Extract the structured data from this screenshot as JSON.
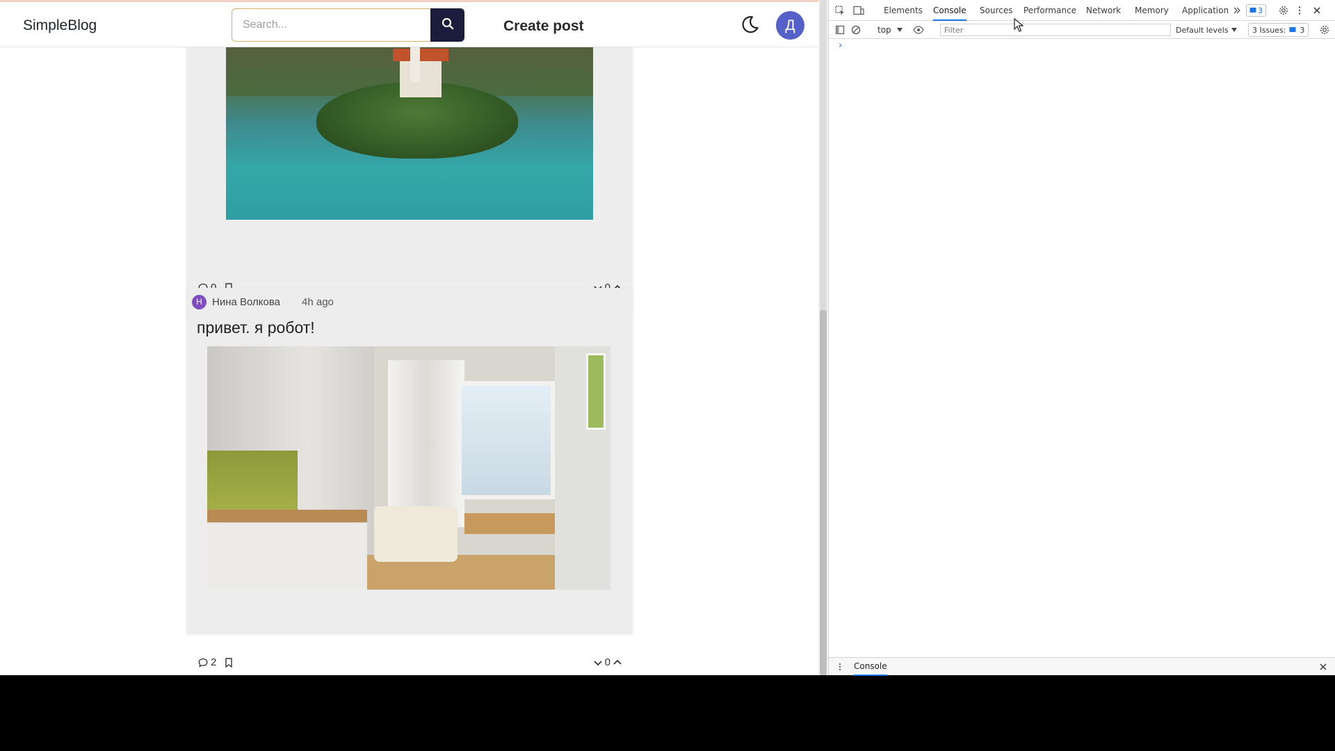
{
  "app": {
    "brand": "SimpleBlog",
    "search": {
      "placeholder": "Search..."
    },
    "create_post_label": "Create post",
    "user_avatar_letter": "Д",
    "accent_color": "#1c1d3d",
    "avatar_color": "#5561c9"
  },
  "posts": [
    {
      "image_alt": "lake island with church",
      "comments_count": "0",
      "votes": "0"
    },
    {
      "author_initial": "Н",
      "author_name": "Нина Волкова",
      "time": "4h ago",
      "title": "привет. я робот!",
      "image_alt": "kitchen interior",
      "comments_count": "2",
      "votes": "0"
    }
  ],
  "devtools": {
    "tabs": [
      "Elements",
      "Console",
      "Sources",
      "Performance",
      "Network",
      "Memory",
      "Application"
    ],
    "active_tab": "Console",
    "errors_badge": "3",
    "context": "top",
    "filter_placeholder": "Filter",
    "levels_label": "Default levels",
    "issues_label": "3 Issues:",
    "issues_count": "3",
    "prompt_symbol": "›",
    "drawer_tab": "Console"
  }
}
